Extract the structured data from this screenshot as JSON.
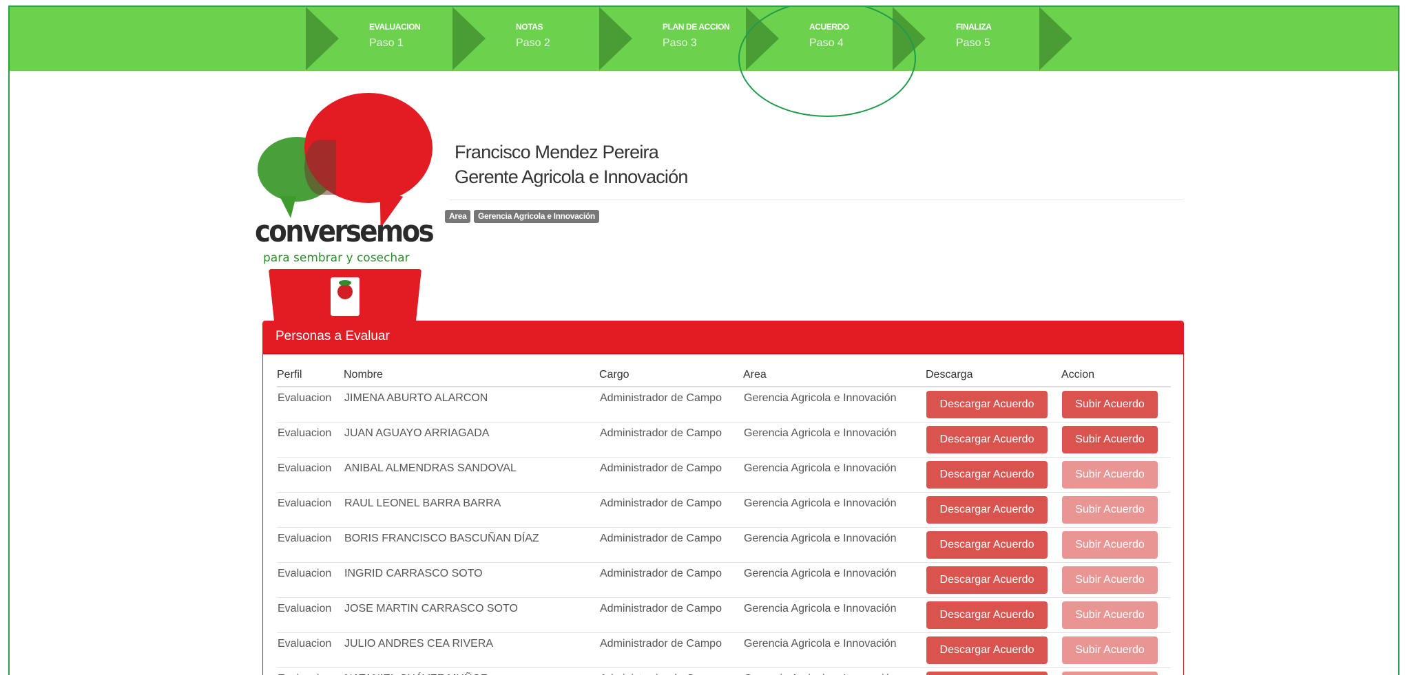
{
  "stepper": {
    "steps": [
      {
        "title": "EVALUACION",
        "sub": "Paso 1"
      },
      {
        "title": "NOTAS",
        "sub": "Paso 2"
      },
      {
        "title": "PLAN DE ACCION",
        "sub": "Paso 3"
      },
      {
        "title": "ACUERDO",
        "sub": "Paso 4"
      },
      {
        "title": "FINALIZA",
        "sub": "Paso 5"
      }
    ]
  },
  "logo": {
    "brand": "conversemos",
    "tagline": "para sembrar y cosechar"
  },
  "user": {
    "name": "Francisco Mendez Pereira",
    "role": "Gerente Agricola e Innovación",
    "area_label": "Area",
    "area_value": "Gerencia Agricola e Innovación"
  },
  "panel": {
    "title": "Personas a Evaluar",
    "columns": [
      "Perfil",
      "Nombre",
      "Cargo",
      "Area",
      "Descarga",
      "Accion"
    ],
    "download_label": "Descargar Acuerdo",
    "upload_label": "Subir Acuerdo",
    "rows": [
      {
        "perfil": "Evaluacion",
        "nombre": "JIMENA ABURTO ALARCON",
        "cargo": "Administrador de Campo",
        "area": "Gerencia Agricola e Innovación",
        "upload_enabled": true
      },
      {
        "perfil": "Evaluacion",
        "nombre": "JUAN AGUAYO ARRIAGADA",
        "cargo": "Administrador de Campo",
        "area": "Gerencia Agricola e Innovación",
        "upload_enabled": true
      },
      {
        "perfil": "Evaluacion",
        "nombre": "ANIBAL ALMENDRAS SANDOVAL",
        "cargo": "Administrador de Campo",
        "area": "Gerencia Agricola e Innovación",
        "upload_enabled": false
      },
      {
        "perfil": "Evaluacion",
        "nombre": "RAUL LEONEL BARRA BARRA",
        "cargo": "Administrador de Campo",
        "area": "Gerencia Agricola e Innovación",
        "upload_enabled": false
      },
      {
        "perfil": "Evaluacion",
        "nombre": "BORIS FRANCISCO BASCUÑAN DÍAZ",
        "cargo": "Administrador de Campo",
        "area": "Gerencia Agricola e Innovación",
        "upload_enabled": false
      },
      {
        "perfil": "Evaluacion",
        "nombre": "INGRID CARRASCO SOTO",
        "cargo": "Administrador de Campo",
        "area": "Gerencia Agricola e Innovación",
        "upload_enabled": false
      },
      {
        "perfil": "Evaluacion",
        "nombre": "JOSE MARTIN CARRASCO SOTO",
        "cargo": "Administrador de Campo",
        "area": "Gerencia Agricola e Innovación",
        "upload_enabled": false
      },
      {
        "perfil": "Evaluacion",
        "nombre": "JULIO ANDRES CEA RIVERA",
        "cargo": "Administrador de Campo",
        "area": "Gerencia Agricola e Innovación",
        "upload_enabled": false
      },
      {
        "perfil": "Evaluacion",
        "nombre": "NATANIEL CHÁVEZ MUÑOZ",
        "cargo": "Administrador de Campo",
        "area": "Gerencia Agricola e Innovación",
        "upload_enabled": false
      }
    ]
  },
  "colors": {
    "stepper_bg": "#6cd14d",
    "stepper_arrow": "#4a9c34",
    "brand_red": "#e31b23",
    "button_red": "#d9534f",
    "button_red_disabled": "#e99593",
    "highlight_ring": "#1f9b4c"
  }
}
